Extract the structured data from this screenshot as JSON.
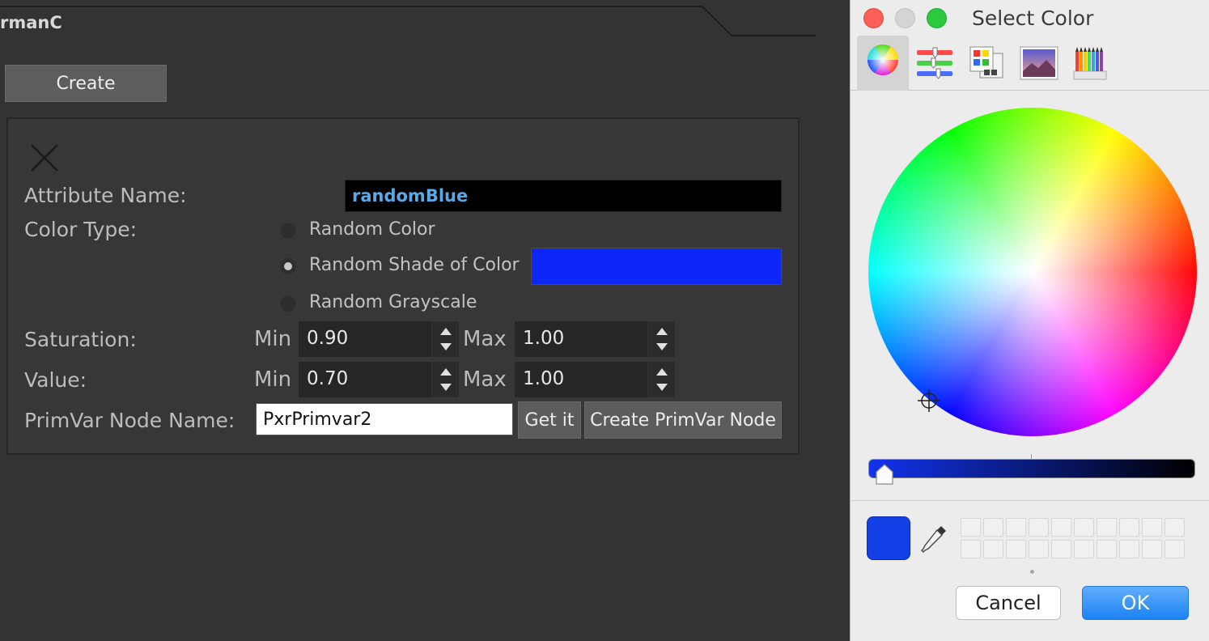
{
  "maya": {
    "tab_title": "rmanC",
    "create_label": "Create",
    "attribute_name_label": "Attribute Name:",
    "attribute_name_value": "randomBlue",
    "color_type_label": "Color Type:",
    "color_types": [
      {
        "label": "Random Color",
        "selected": false
      },
      {
        "label": "Random Shade of Color",
        "selected": true
      },
      {
        "label": "Random Grayscale",
        "selected": false
      }
    ],
    "shade_color": "#0b26f6",
    "saturation_label": "Saturation:",
    "value_label": "Value:",
    "min_label": "Min",
    "max_label": "Max",
    "saturation_min": "0.90",
    "saturation_max": "1.00",
    "value_min": "0.70",
    "value_max": "1.00",
    "primvar_label": "PrimVar Node Name:",
    "primvar_value": "PxrPrimvar2",
    "get_it_label": "Get it",
    "create_primvar_label": "Create PrimVar Node"
  },
  "picker": {
    "title": "Select Color",
    "toolbar_icons": [
      "color-wheel-icon",
      "color-sliders-icon",
      "color-palettes-icon",
      "image-palettes-icon",
      "pencils-icon"
    ],
    "current_color": "#1240e6",
    "brightness_level": 0.02,
    "cancel_label": "Cancel",
    "ok_label": "OK"
  }
}
